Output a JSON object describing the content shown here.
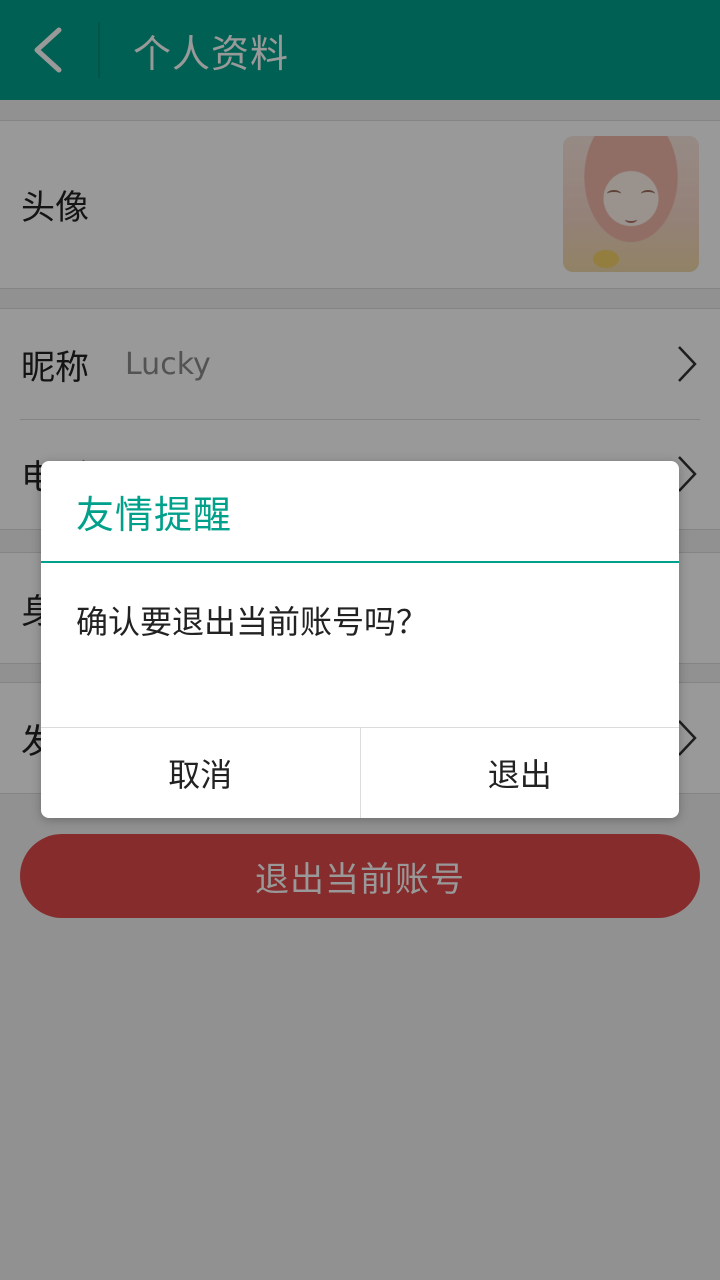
{
  "header": {
    "title": "个人资料"
  },
  "profile": {
    "avatar_label": "头像",
    "rows": [
      {
        "label": "昵称",
        "value": "Lucky"
      },
      {
        "label": "电话",
        "value": ""
      },
      {
        "label": "身份",
        "value": ""
      },
      {
        "label": "发布",
        "value": ""
      }
    ]
  },
  "logout_button": "退出当前账号",
  "dialog": {
    "title": "友情提醒",
    "message": "确认要退出当前账号吗？",
    "cancel": "取消",
    "confirm": "退出"
  },
  "colors": {
    "accent": "#00a08a",
    "danger": "#e04a4a"
  },
  "icons": {
    "back": "back-arrow-icon",
    "chevron": "chevron-right-icon"
  }
}
